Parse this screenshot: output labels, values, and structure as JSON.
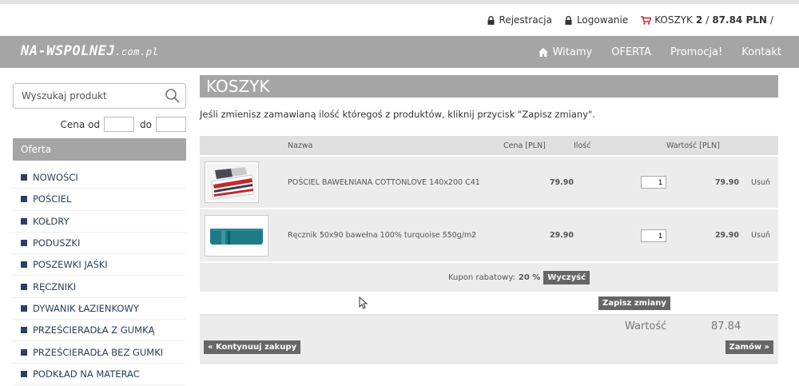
{
  "toplinks": {
    "register": "Rejestracja",
    "login": "Logowanie",
    "cart_label": "KOSZYK",
    "cart_count": "2",
    "cart_separator": "/",
    "cart_total": "87.84 PLN",
    "cart_trailing": "/"
  },
  "logo": {
    "main": "NA-WSPOLNEJ",
    "suffix": ".com.pl"
  },
  "nav": {
    "welcome": "Witamy",
    "offer": "OFERTA",
    "promo": "Promocja!",
    "contact": "Kontakt"
  },
  "sidebar": {
    "search_placeholder": "Wyszukaj produkt",
    "price_from": "Cena od",
    "price_to": "do",
    "category_heading": "Oferta",
    "categories": [
      "NOWOŚCI",
      "POŚCIEL",
      "KOŁDRY",
      "PODUSZKI",
      "POSZEWKI JAŚKI",
      "RĘCZNIKI",
      "DYWANIK ŁAZIENKOWY",
      "PRZEŚCIERADŁA Z GUMKĄ",
      "PRZEŚCIERADŁA BEZ GUMKI",
      "PODKŁAD NA MATERAC"
    ]
  },
  "main": {
    "title": "KOSZYK",
    "info": "Jeśli zmienisz zamawianą ilość któregoś z produktów, kliknij przycisk \"Zapisz zmiany\".",
    "columns": {
      "name": "Nazwa",
      "price": "Cena [PLN]",
      "qty": "Ilość",
      "value": "Wartość [PLN]"
    },
    "items": [
      {
        "name": "POŚCIEL BAWEŁNIANA COTTONLOVE 140x200 C41",
        "price": "79.90",
        "qty": "1",
        "value": "79.90",
        "remove": "Usuń"
      },
      {
        "name": "Ręcznik 50x90 bawełna 100% turquoise 550g/m2",
        "price": "29.90",
        "qty": "1",
        "value": "29.90",
        "remove": "Usuń"
      }
    ],
    "coupon_label": "Kupon rabatowy:",
    "coupon_value": "20 %",
    "clear_button": "Wyczyść",
    "save_button": "Zapisz zmiany",
    "total_label": "Wartość",
    "total_value": "87.84",
    "continue_button": "« Kontynuuj zakupy",
    "order_button": "Zamów »"
  },
  "colors": {
    "bar_gray": "#a5a5a5",
    "link_navy": "#2a3f5a",
    "cart_red": "#c0282d"
  }
}
